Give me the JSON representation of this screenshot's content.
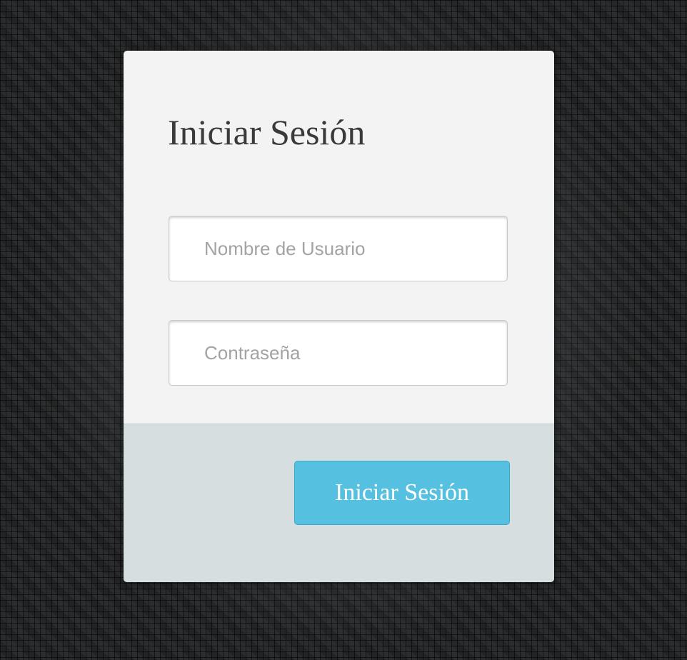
{
  "login_form": {
    "title": "Iniciar Sesión",
    "username": {
      "placeholder": "Nombre de Usuario",
      "value": ""
    },
    "password": {
      "placeholder": "Contraseña",
      "value": ""
    },
    "submit_label": "Iniciar Sesión"
  },
  "colors": {
    "card_background": "#f3f3f3",
    "footer_background": "#d6dee0",
    "button_accent": "#56c0e0",
    "title_text": "#3a3a3a",
    "placeholder_text": "#a3a3a3"
  }
}
